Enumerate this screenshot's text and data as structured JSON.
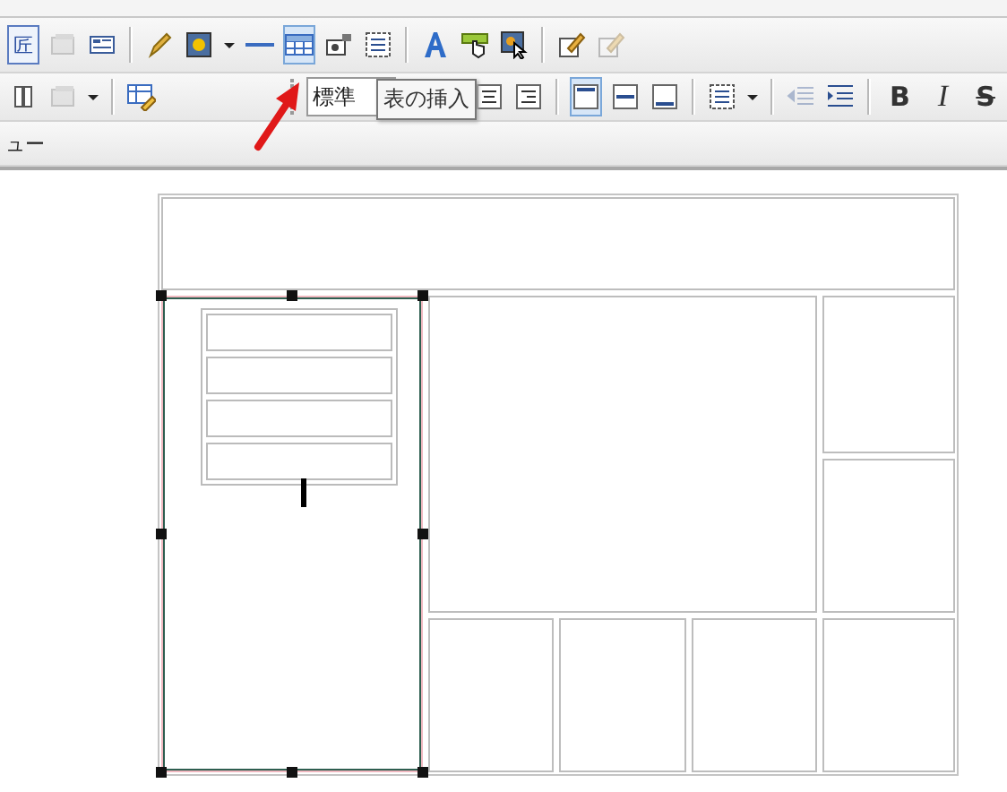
{
  "toolbar_1": [
    {
      "kind": "glyph",
      "label": "匠"
    },
    {
      "kind": "window",
      "disabled": true,
      "selected": false
    },
    {
      "kind": "panel",
      "disabled": false,
      "selected": false
    },
    {
      "kind": "separator"
    },
    {
      "kind": "pen",
      "disabled": false,
      "selected": false
    },
    {
      "kind": "image",
      "disabled": false,
      "selected": false
    },
    {
      "kind": "caret",
      "disabled": false,
      "selected": false
    },
    {
      "kind": "rule",
      "disabled": false,
      "selected": false
    },
    {
      "kind": "table",
      "disabled": false,
      "selected": true
    },
    {
      "kind": "form",
      "disabled": false,
      "selected": false
    },
    {
      "kind": "list",
      "disabled": false,
      "selected": false
    },
    {
      "kind": "separator"
    },
    {
      "kind": "letter",
      "disabled": false,
      "selected": false
    },
    {
      "kind": "hand",
      "disabled": false,
      "selected": false
    },
    {
      "kind": "pointer",
      "disabled": false,
      "selected": false
    },
    {
      "kind": "separator"
    },
    {
      "kind": "edit",
      "disabled": false,
      "selected": false
    },
    {
      "kind": "edit",
      "disabled": true,
      "selected": false
    }
  ],
  "toolbar_2_left": [
    {
      "kind": "columns",
      "disabled": false,
      "selected": false
    },
    {
      "kind": "window",
      "disabled": true,
      "selected": false
    },
    {
      "kind": "caret",
      "disabled": false,
      "selected": false
    },
    {
      "kind": "separator"
    },
    {
      "kind": "tableedit",
      "disabled": false,
      "selected": false
    }
  ],
  "style_dropdown": {
    "value": "標準"
  },
  "toolbar_2_right": [
    {
      "kind": "center",
      "disabled": false,
      "selected": false
    },
    {
      "kind": "right",
      "disabled": false,
      "selected": false
    },
    {
      "kind": "separator"
    },
    {
      "kind": "top",
      "disabled": false,
      "selected": true
    },
    {
      "kind": "middle",
      "disabled": false,
      "selected": false
    },
    {
      "kind": "bottom",
      "disabled": false,
      "selected": false
    },
    {
      "kind": "separator"
    },
    {
      "kind": "list",
      "disabled": false,
      "selected": false
    },
    {
      "kind": "caret",
      "disabled": false,
      "selected": false
    },
    {
      "kind": "separator"
    },
    {
      "kind": "outdent",
      "disabled": true,
      "selected": false
    },
    {
      "kind": "indent",
      "disabled": false,
      "selected": false
    },
    {
      "kind": "separator"
    },
    {
      "kind": "bold",
      "label": "B",
      "disabled": false,
      "selected": false
    },
    {
      "kind": "italic",
      "label": "I",
      "disabled": false,
      "selected": false
    },
    {
      "kind": "strike",
      "label": "S",
      "disabled": false,
      "selected": false
    }
  ],
  "tooltip": "表の挿入",
  "view_label": "ュー",
  "layout_table": {
    "cells": [
      {
        "kind": "empty",
        "selected": false
      },
      {
        "kind": "nested_table",
        "selected": true
      },
      {
        "kind": "empty",
        "selected": false
      },
      {
        "kind": "empty",
        "selected": false
      },
      {
        "kind": "empty",
        "selected": false
      },
      {
        "kind": "empty",
        "selected": false
      },
      {
        "kind": "empty",
        "selected": false
      },
      {
        "kind": "empty",
        "selected": false
      },
      {
        "kind": "empty",
        "selected": false
      }
    ]
  }
}
